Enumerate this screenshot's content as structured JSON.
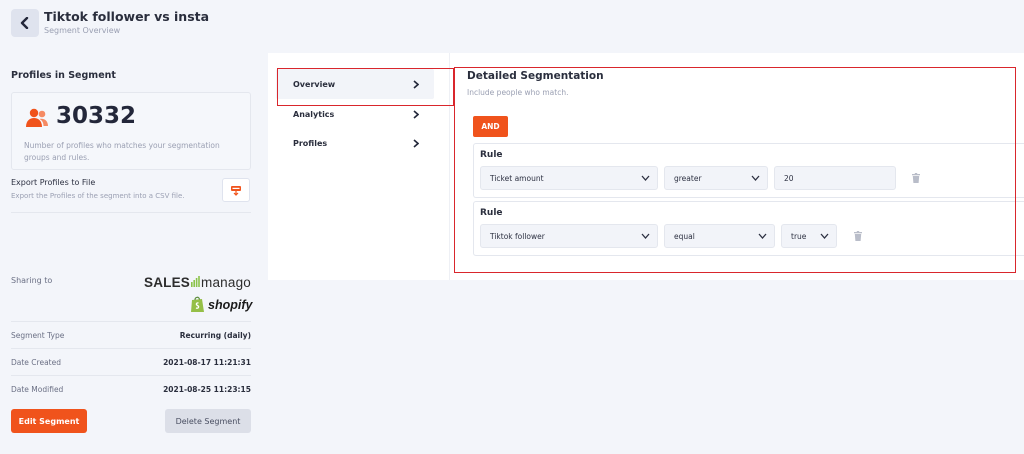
{
  "header": {
    "title": "Tiktok follower vs insta",
    "subtitle": "Segment Overview",
    "back_icon": "chevron-left-icon"
  },
  "profiles": {
    "heading": "Profiles in Segment",
    "count": "30332",
    "count_icon": "users-icon",
    "description": "Number of profiles who matches your segmentation groups and rules.",
    "accent_color": "#f0531c"
  },
  "export": {
    "title": "Export Profiles to File",
    "description": "Export the Profiles of the segment into a CSV file.",
    "icon": "csv-file-icon"
  },
  "sharing": {
    "label": "Sharing to",
    "logo_sales": "SALES",
    "logo_manago": "manago",
    "logo_shopify": "shopify"
  },
  "info": [
    {
      "key": "Segment Type",
      "value": "Recurring (daily)"
    },
    {
      "key": "Date Created",
      "value": "2021-08-17 11:21:31"
    },
    {
      "key": "Date Modified",
      "value": "2021-08-25 11:23:15"
    }
  ],
  "actions": {
    "edit_label": "Edit Segment",
    "delete_label": "Delete Segment"
  },
  "tabs": [
    {
      "label": "Overview",
      "active": true
    },
    {
      "label": "Analytics",
      "active": false
    },
    {
      "label": "Profiles",
      "active": false
    }
  ],
  "segmentation": {
    "title": "Detailed Segmentation",
    "subtitle": "Include people who match.",
    "operator": "AND",
    "rules": [
      {
        "label": "Rule",
        "field": "Ticket amount",
        "comparator": "greater",
        "value": "20"
      },
      {
        "label": "Rule",
        "field": "Tiktok follower",
        "comparator": "equal",
        "value": "true"
      }
    ]
  },
  "colors": {
    "primary": "#f0531c",
    "highlight": "#d9262c",
    "background": "#f3f5fa"
  }
}
